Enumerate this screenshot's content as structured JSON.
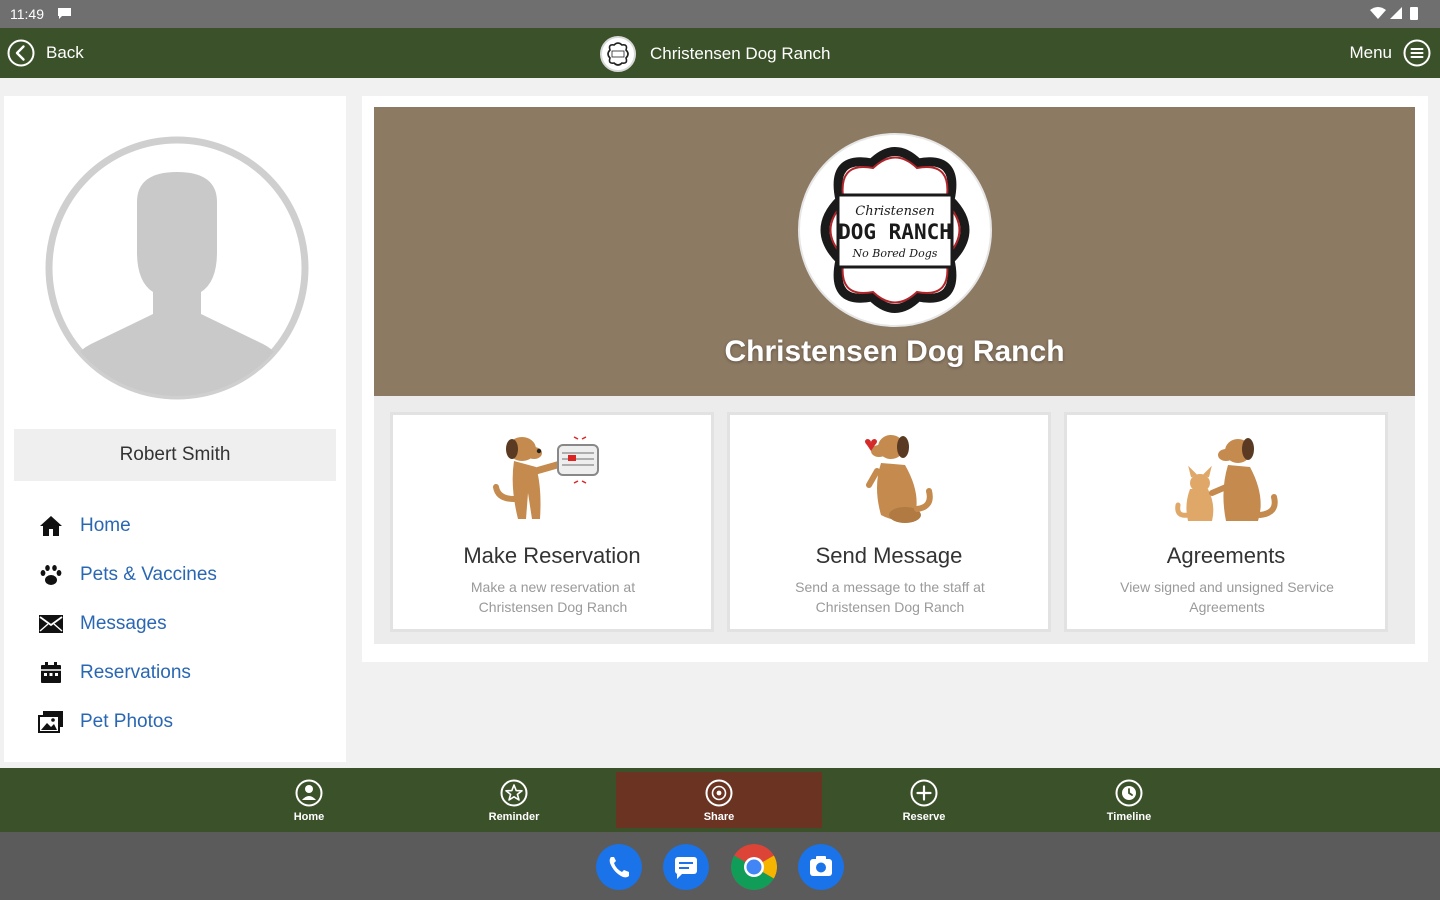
{
  "status_bar": {
    "time": "11:49"
  },
  "header": {
    "back_label": "Back",
    "title": "Christensen Dog Ranch",
    "menu_label": "Menu"
  },
  "sidebar": {
    "user_name": "Robert Smith",
    "items": [
      {
        "label": "Home",
        "icon": "home-icon"
      },
      {
        "label": "Pets & Vaccines",
        "icon": "paw-icon"
      },
      {
        "label": "Messages",
        "icon": "envelope-icon"
      },
      {
        "label": "Reservations",
        "icon": "calendar-icon"
      },
      {
        "label": "Pet Photos",
        "icon": "photos-icon"
      }
    ]
  },
  "banner": {
    "business_name": "Christensen Dog Ranch",
    "logo_text": {
      "line1": "Christensen",
      "line2": "DOG RANCH",
      "line3": "No Bored Dogs"
    }
  },
  "cards": [
    {
      "title": "Make Reservation",
      "description": "Make a new reservation at Christensen Dog Ranch",
      "icon": "dog-calendar-illustration"
    },
    {
      "title": "Send Message",
      "description": "Send a message to the staff at Christensen Dog Ranch",
      "icon": "dog-heart-illustration"
    },
    {
      "title": "Agreements",
      "description": "View signed and unsigned Service Agreements",
      "icon": "dog-puppy-illustration"
    }
  ],
  "tabbar": {
    "active": "Share",
    "tabs": [
      {
        "label": "Home",
        "icon": "user-circle-icon"
      },
      {
        "label": "Reminder",
        "icon": "star-circle-icon"
      },
      {
        "label": "Share",
        "icon": "share-circle-icon"
      },
      {
        "label": "Reserve",
        "icon": "plus-circle-icon"
      },
      {
        "label": "Timeline",
        "icon": "timeline-circle-icon"
      }
    ]
  },
  "dock": {
    "apps": [
      "phone-app-icon",
      "messages-app-icon",
      "chrome-app-icon",
      "camera-app-icon"
    ]
  },
  "colors": {
    "header_green": "#3b5129",
    "banner_brown": "#8d7a63",
    "active_tab": "#6b3322",
    "link_blue": "#2a67b3"
  }
}
